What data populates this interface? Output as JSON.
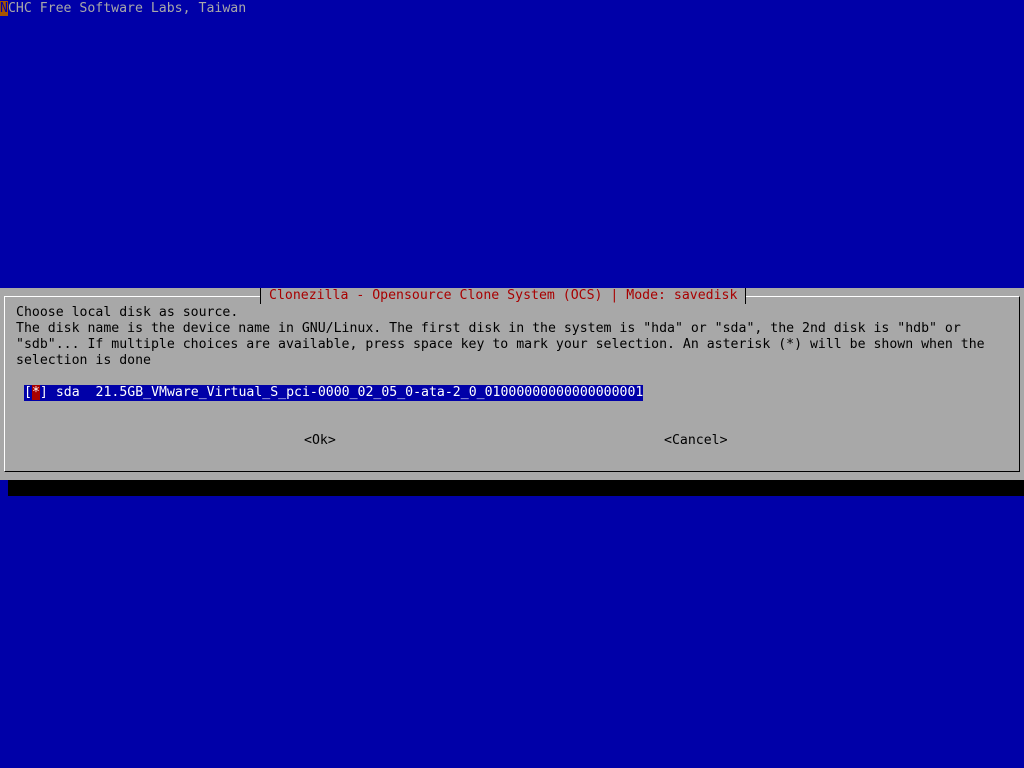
{
  "backtitle": {
    "cursor_char": "N",
    "rest": "CHC Free Software Labs, Taiwan"
  },
  "dialog": {
    "title": "Clonezilla - Opensource Clone System (OCS) | Mode: savedisk",
    "prompt_lines": [
      "Choose local disk as source.",
      "The disk name is the device name in GNU/Linux. The first disk in the system is \"hda\" or \"sda\", the 2nd disk is \"hdb\" or",
      "\"sdb\"... If multiple choices are available, press space key to mark your selection. An asterisk (*) will be shown when the",
      "selection is done"
    ],
    "options": [
      {
        "bracket_open": "[",
        "mark": "*",
        "bracket_close": "]",
        "tag": "sda",
        "description": "21.5GB_VMware_Virtual_S_pci-0000_02_05_0-ata-2_0_01000000000000000001",
        "selected": true
      }
    ],
    "buttons": {
      "ok": "<Ok>",
      "cancel": "<Cancel>"
    }
  },
  "colors": {
    "background": "#0000a8",
    "dialog": "#a8a8a8",
    "title_text": "#a80000",
    "highlight": "#0000a8",
    "mark_highlight": "#a80000",
    "cursor": "#a85400"
  }
}
